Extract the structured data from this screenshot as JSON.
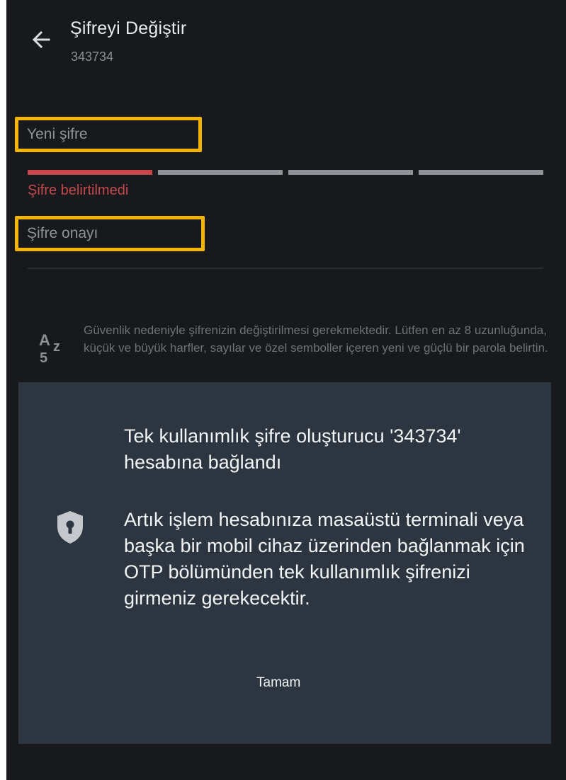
{
  "header": {
    "title": "Şifreyi Değiştir",
    "subtitle": "343734",
    "back_icon": "arrow-left-icon"
  },
  "form": {
    "new_password_placeholder": "Yeni şifre",
    "confirm_password_placeholder": "Şifre onayı",
    "strength_label": "Şifre belirtilmedi",
    "strength_level": "1 of 4",
    "colors": {
      "weak": "#c8474a",
      "inactive": "#8e9196",
      "highlight": "#f5b400"
    }
  },
  "hint": {
    "icon": "az5-icon",
    "text": "Güvenlik nedeniyle şifrenizin değiştirilmesi gerekmektedir. Lütfen en az 8 uzunluğunda, küçük ve büyük harfler, sayılar ve özel semboller içeren yeni ve güçlü bir parola belirtin."
  },
  "dialog": {
    "icon": "shield-keyhole-icon",
    "heading": "Tek kullanımlık şifre oluşturucu '343734' hesabına bağlandı",
    "body": "Artık işlem hesabınıza masaüstü terminali veya başka bir mobil cihaz üzerinden bağlanmak için OTP bölümünden tek kullanımlık şifrenizi girmeniz gerekecektir.",
    "ok_label": "Tamam"
  }
}
